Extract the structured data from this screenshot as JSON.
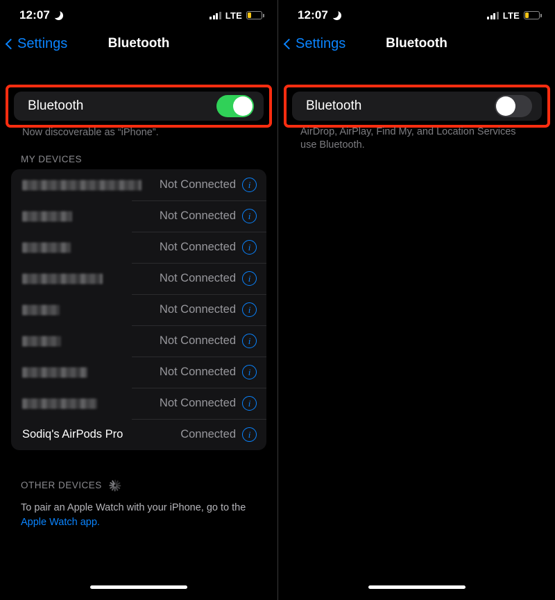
{
  "status_bar": {
    "time": "12:07",
    "moon_icon": "crescent-moon-icon",
    "carrier": "LTE",
    "signal_icon": "signal-bars-icon",
    "battery_icon": "battery-low-icon",
    "battery_color": "#f5c518"
  },
  "nav": {
    "back_label": "Settings",
    "back_icon": "chevron-left-icon",
    "title": "Bluetooth"
  },
  "colors": {
    "accent_blue": "#0a84ff",
    "toggle_on_green": "#30d158",
    "toggle_off_gray": "#39393d",
    "highlight_red": "#ff2d10",
    "card_bg": "#1c1c1e"
  },
  "left_panel": {
    "bluetooth_row": {
      "label": "Bluetooth",
      "toggle_state": "on",
      "highlighted": true
    },
    "note": "Now discoverable as “iPhone”.",
    "my_devices_header": "MY DEVICES",
    "devices": [
      {
        "name": "",
        "redacted": true,
        "redact_width": 172,
        "status": "Not Connected"
      },
      {
        "name": "",
        "redacted": true,
        "redact_width": 72,
        "status": "Not Connected"
      },
      {
        "name": "",
        "redacted": true,
        "redact_width": 70,
        "status": "Not Connected"
      },
      {
        "name": "",
        "redacted": true,
        "redact_width": 116,
        "status": "Not Connected"
      },
      {
        "name": "",
        "redacted": true,
        "redact_width": 54,
        "status": "Not Connected"
      },
      {
        "name": "",
        "redacted": true,
        "redact_width": 56,
        "status": "Not Connected"
      },
      {
        "name": "",
        "redacted": true,
        "redact_width": 94,
        "status": "Not Connected"
      },
      {
        "name": "",
        "redacted": true,
        "redact_width": 108,
        "status": "Not Connected"
      },
      {
        "name": "Sodiq's AirPods Pro",
        "redacted": false,
        "redact_width": 0,
        "status": "Connected"
      }
    ],
    "other_devices_header": "OTHER DEVICES",
    "spinner_icon": "loading-spinner-icon",
    "pair_note_text": "To pair an Apple Watch with your iPhone, go to the ",
    "pair_note_link": "Apple Watch app."
  },
  "right_panel": {
    "bluetooth_row": {
      "label": "Bluetooth",
      "toggle_state": "off",
      "highlighted": true
    },
    "note": "AirDrop, AirPlay, Find My, and Location Services use Bluetooth."
  }
}
